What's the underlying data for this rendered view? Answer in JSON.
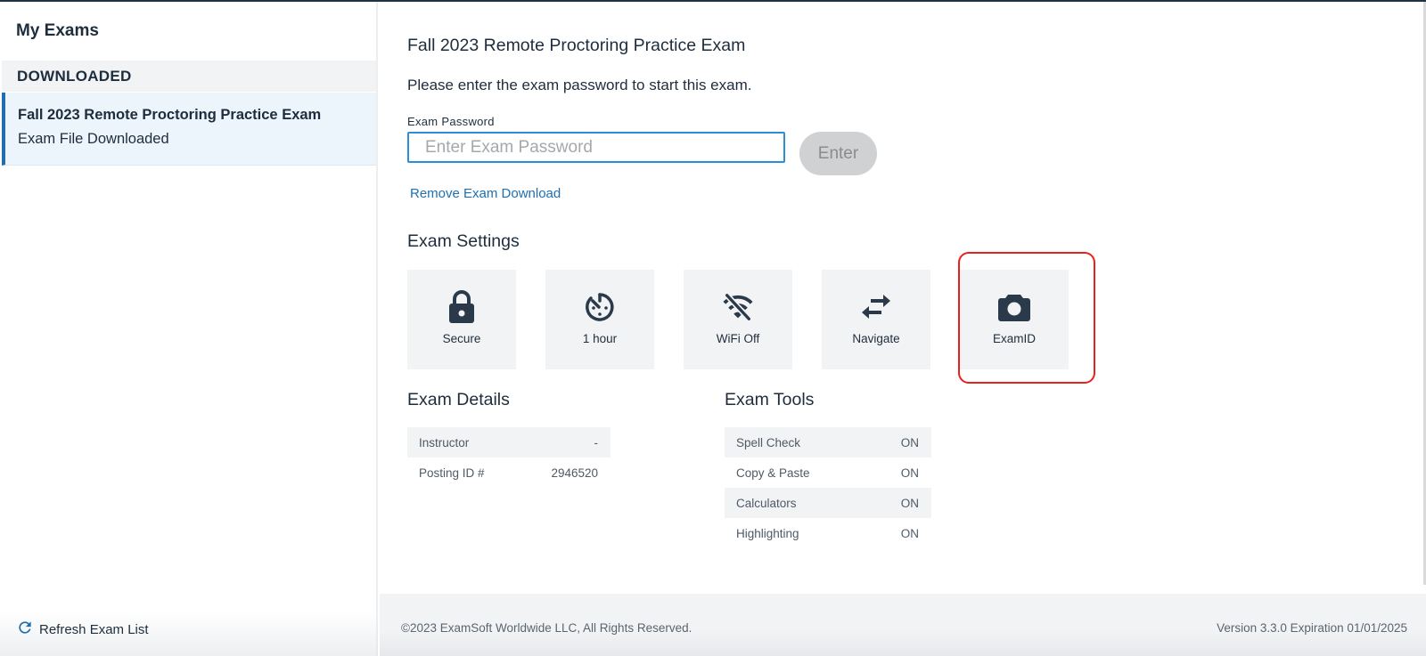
{
  "sidebar": {
    "title": "My Exams",
    "section_header": "DOWNLOADED",
    "exams": [
      {
        "title": "Fall 2023 Remote Proctoring Practice Exam",
        "status": "Exam File Downloaded"
      }
    ],
    "refresh_label": "Refresh Exam List",
    "refresh_icon": "refresh-icon"
  },
  "main": {
    "exam_title": "Fall 2023 Remote Proctoring Practice Exam",
    "instructions": "Please enter the exam password to start this exam.",
    "password": {
      "label": "Exam Password",
      "value": "",
      "placeholder": "Enter Exam Password"
    },
    "enter_button": "Enter",
    "remove_link": "Remove Exam Download",
    "settings": {
      "title": "Exam Settings",
      "items": [
        {
          "label": "Secure",
          "icon": "lock-icon"
        },
        {
          "label": "1 hour",
          "icon": "timer-icon"
        },
        {
          "label": "WiFi Off",
          "icon": "wifi-off-icon"
        },
        {
          "label": "Navigate",
          "icon": "swap-arrows-icon"
        },
        {
          "label": "ExamID",
          "icon": "camera-icon",
          "highlighted": true
        }
      ]
    },
    "details": {
      "title": "Exam Details",
      "rows": [
        {
          "key": "Instructor",
          "value": "-"
        },
        {
          "key": "Posting ID #",
          "value": "2946520"
        }
      ]
    },
    "tools": {
      "title": "Exam Tools",
      "rows": [
        {
          "key": "Spell Check",
          "value": "ON"
        },
        {
          "key": "Copy & Paste",
          "value": "ON"
        },
        {
          "key": "Calculators",
          "value": "ON"
        },
        {
          "key": "Highlighting",
          "value": "ON"
        }
      ]
    }
  },
  "footer": {
    "copyright": "©2023 ExamSoft Worldwide LLC, All Rights Reserved.",
    "version": "Version 3.3.0 Expiration 01/01/2025"
  },
  "colors": {
    "accent": "#1f6fb0",
    "input_focus": "#2a8fd6",
    "highlight": "#e8221b",
    "text": "#1e2d3d",
    "card_bg": "#f2f3f5"
  }
}
